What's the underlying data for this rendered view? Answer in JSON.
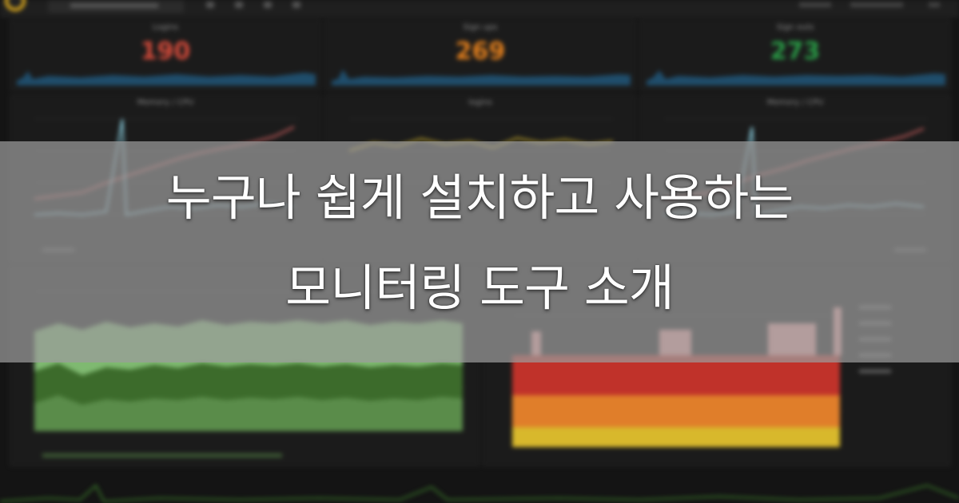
{
  "stats": [
    {
      "title": "Logins",
      "value": "190",
      "color": "#d44a3a"
    },
    {
      "title": "Sign ups",
      "value": "269",
      "color": "#e5801c"
    },
    {
      "title": "Sign outs",
      "value": "273",
      "color": "#299c46"
    }
  ],
  "graph_panels": {
    "memory_cpu_left": "Memory / CPU",
    "logins": "logins",
    "memory_cpu_right": "Memory / CPU"
  },
  "colors": {
    "spark": "#1f4d6b",
    "memory_line": "#e26767",
    "cpu_line": "#8fd6e8",
    "area_green": "#7fb971",
    "area_dark_green": "#3c6b2b",
    "bar_red": "#c0322a",
    "bar_orange": "#e07e2a",
    "bar_yellow": "#d8b82c",
    "bar_pink": "#f0a0a0"
  },
  "headline": {
    "line1": "누구나 쉽게 설치하고 사용하는",
    "line2": "모니터링 도구 소개"
  }
}
